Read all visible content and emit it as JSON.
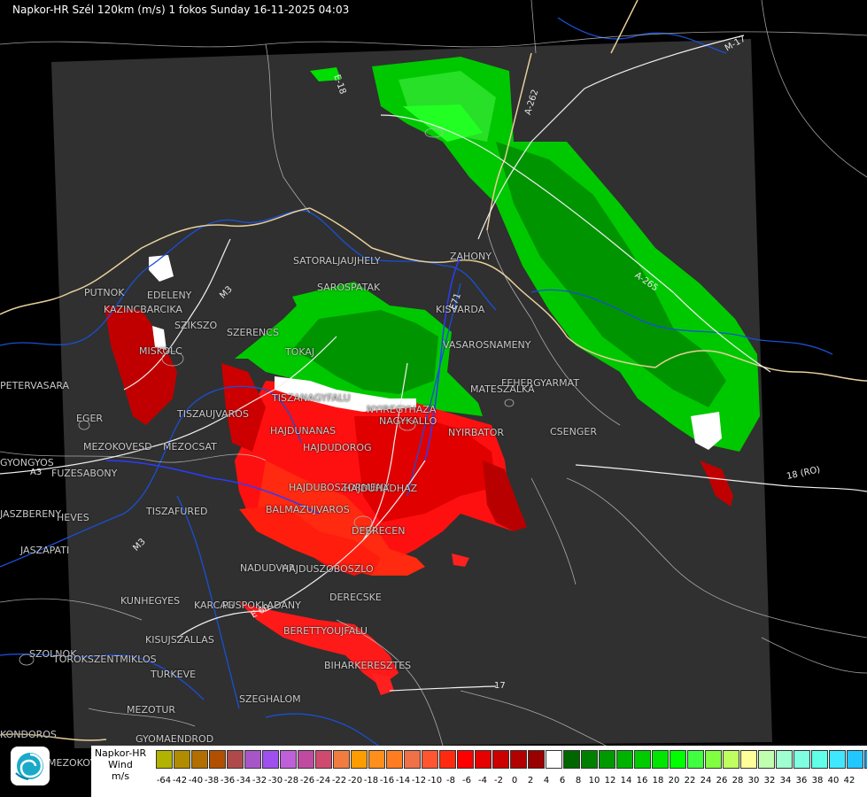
{
  "title": "Napkor-HR Szél 120km (m/s) 1 fokos Sunday 16-11-2025 04:03",
  "legend": {
    "title_lines": [
      "Napkor-HR",
      "Wind",
      "m/s"
    ],
    "ticks": [
      "-64",
      "-42",
      "-40",
      "-38",
      "-36",
      "-34",
      "-32",
      "-30",
      "-28",
      "-26",
      "-24",
      "-22",
      "-20",
      "-18",
      "-16",
      "-14",
      "-12",
      "-10",
      "-8",
      "-6",
      "-4",
      "-2",
      "0",
      "2",
      "4",
      "6",
      "8",
      "10",
      "12",
      "14",
      "16",
      "18",
      "20",
      "22",
      "24",
      "26",
      "28",
      "30",
      "32",
      "34",
      "36",
      "38",
      "40",
      "42"
    ],
    "colors": [
      "#b2b200",
      "#b28c00",
      "#b26e00",
      "#b05000",
      "#b04a4a",
      "#a855c8",
      "#9f4ef0",
      "#c060d8",
      "#c04aa0",
      "#d04a70",
      "#f07c40",
      "#ff9c00",
      "#ff8e1a",
      "#ff7c20",
      "#f07048",
      "#ff5530",
      "#ff2a10",
      "#ff0000",
      "#e60000",
      "#cc0000",
      "#b30000",
      "#990000",
      "#ffffff",
      "#006600",
      "#008000",
      "#009900",
      "#00b300",
      "#00cc00",
      "#00e600",
      "#00ff00",
      "#40ff40",
      "#80ff40",
      "#c0ff60",
      "#ffff99",
      "#c0ffb0",
      "#a0ffd0",
      "#80ffe0",
      "#60ffe8",
      "#40e8ff",
      "#20c8ff",
      "#00a0ff",
      "#0070ff",
      "#0040ff",
      "#0000ff"
    ]
  },
  "cities": [
    "SATORALJAUJHELY",
    "ZAHONY",
    "SAROSPATAK",
    "KISVARDA",
    "PUTNOK",
    "EDELENY",
    "KAZINCBARCIKA",
    "SZIKSZO",
    "SZERENCS",
    "TOKAJ",
    "VASAROSNAMENY",
    "MISKOLC",
    "FEHERGYARMAT",
    "MATESZALKA",
    "PETERVASARA",
    "TISZANAGYFALU",
    "NYIREGYHAZA",
    "NAGYKALLO",
    "EGER",
    "TISZAUJVAROS",
    "HAJDUNANAS",
    "NYIRBATOR",
    "CSENGER",
    "MEZOKOVESD",
    "MEZOCSAT",
    "HAJDUDOROG",
    "GYONGYOS",
    "FUZESABONY",
    "HAJDUBOSZORMENY",
    "HAJDUHADHAZ",
    "HEVES",
    "TISZAFURED",
    "BALMAZUJVAROS",
    "JASZAPATI",
    "DEBRECEN",
    "NADUDVAR",
    "HAJDUSZOBOSZLO",
    "KUNHEGYES",
    "KARCAG",
    "PUSPOKLADANY",
    "DERECSKE",
    "KISUJSZALLAS",
    "BERETTYOUJFALU",
    "SZOLNOK",
    "TOROKSZENTMIKLOS",
    "BIHARKERESZTES",
    "TURKEVE",
    "SZEGHALOM",
    "MEZOTUR",
    "JASZBERENY",
    "GYOMAENDROD",
    "KONDOROS",
    "MEZOKOVACSHAZA"
  ],
  "roads": [
    "A-262",
    "M-17",
    "A-265",
    "E-18",
    "18 (RO)",
    "17",
    "E 60",
    "A3",
    "M3",
    "M3",
    "E71"
  ]
}
